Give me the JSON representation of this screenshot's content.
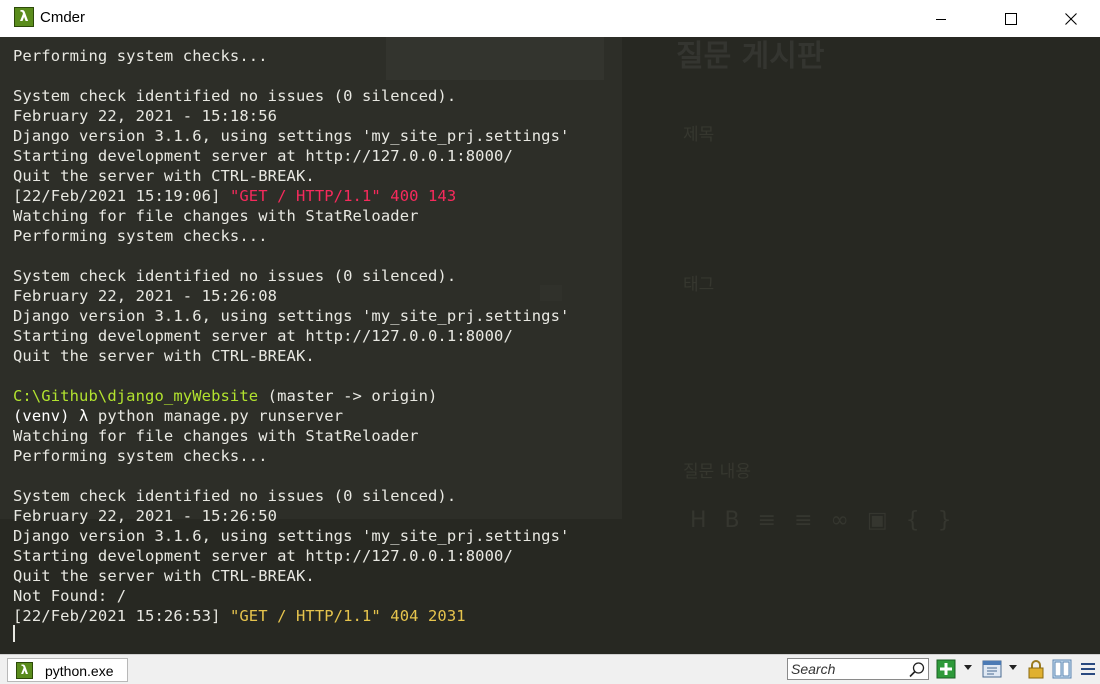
{
  "window": {
    "title": "Cmder",
    "app_icon_glyph": "λ",
    "controls": [
      "minimize-icon",
      "maximize-icon",
      "close-icon"
    ]
  },
  "console": {
    "lines": [
      [
        {
          "t": "Performing system checks...",
          "c": "default"
        }
      ],
      [
        {
          "t": "",
          "c": "default"
        }
      ],
      [
        {
          "t": "System check identified no issues (0 silenced).",
          "c": "default"
        }
      ],
      [
        {
          "t": "February 22, 2021 - 15:18:56",
          "c": "default"
        }
      ],
      [
        {
          "t": "Django version 3.1.6, using settings 'my_site_prj.settings'",
          "c": "default"
        }
      ],
      [
        {
          "t": "Starting development server at http://127.0.0.1:8000/",
          "c": "default"
        }
      ],
      [
        {
          "t": "Quit the server with CTRL-BREAK.",
          "c": "default"
        }
      ],
      [
        {
          "t": "[22/Feb/2021 15:19:06] ",
          "c": "default"
        },
        {
          "t": "\"GET / HTTP/1.1\" 400 143",
          "c": "red"
        }
      ],
      [
        {
          "t": "Watching for file changes with StatReloader",
          "c": "default"
        }
      ],
      [
        {
          "t": "Performing system checks...",
          "c": "default"
        }
      ],
      [
        {
          "t": "",
          "c": "default"
        }
      ],
      [
        {
          "t": "System check identified no issues (0 silenced).",
          "c": "default"
        }
      ],
      [
        {
          "t": "February 22, 2021 - 15:26:08",
          "c": "default"
        }
      ],
      [
        {
          "t": "Django version 3.1.6, using settings 'my_site_prj.settings'",
          "c": "default"
        }
      ],
      [
        {
          "t": "Starting development server at http://127.0.0.1:8000/",
          "c": "default"
        }
      ],
      [
        {
          "t": "Quit the server with CTRL-BREAK.",
          "c": "default"
        }
      ],
      [
        {
          "t": "",
          "c": "default"
        }
      ],
      [
        {
          "t": "C:\\Github\\django_myWebsite",
          "c": "green"
        },
        {
          "t": " (master -> origin)",
          "c": "default"
        }
      ],
      [
        {
          "t": "(venv) ",
          "c": "white"
        },
        {
          "t": "λ",
          "c": "white"
        },
        {
          "t": " python manage.py runserver",
          "c": "default"
        }
      ],
      [
        {
          "t": "Watching for file changes with StatReloader",
          "c": "default"
        }
      ],
      [
        {
          "t": "Performing system checks...",
          "c": "default"
        }
      ],
      [
        {
          "t": "",
          "c": "default"
        }
      ],
      [
        {
          "t": "System check identified no issues (0 silenced).",
          "c": "default"
        }
      ],
      [
        {
          "t": "February 22, 2021 - 15:26:50",
          "c": "default"
        }
      ],
      [
        {
          "t": "Django version 3.1.6, using settings 'my_site_prj.settings'",
          "c": "default"
        }
      ],
      [
        {
          "t": "Starting development server at http://127.0.0.1:8000/",
          "c": "default"
        }
      ],
      [
        {
          "t": "Quit the server with CTRL-BREAK.",
          "c": "default"
        }
      ],
      [
        {
          "t": "Not Found: /",
          "c": "default"
        }
      ],
      [
        {
          "t": "[22/Feb/2021 15:26:53] ",
          "c": "default"
        },
        {
          "t": "\"GET / HTTP/1.1\" 404 2031",
          "c": "yellow"
        }
      ]
    ]
  },
  "background_window": {
    "title": "질문 게시판",
    "labels": [
      "제목",
      "태그",
      "질문 내용"
    ]
  },
  "statusbar": {
    "tab_label": "python.exe",
    "tab_icon_glyph": "λ",
    "search_placeholder": "Search",
    "icons": [
      "search-icon",
      "add-console-icon",
      "dropdown-arrow-icon",
      "console-list-icon",
      "dropdown-arrow-icon",
      "lock-icon",
      "split-view-icon",
      "menu-icon"
    ]
  },
  "colors": {
    "console_bg": "#272822",
    "console_fg": "#e8e8e2",
    "error_red": "#f62a5c",
    "path_green": "#b2e32f",
    "warn_yellow": "#e6c44d"
  }
}
